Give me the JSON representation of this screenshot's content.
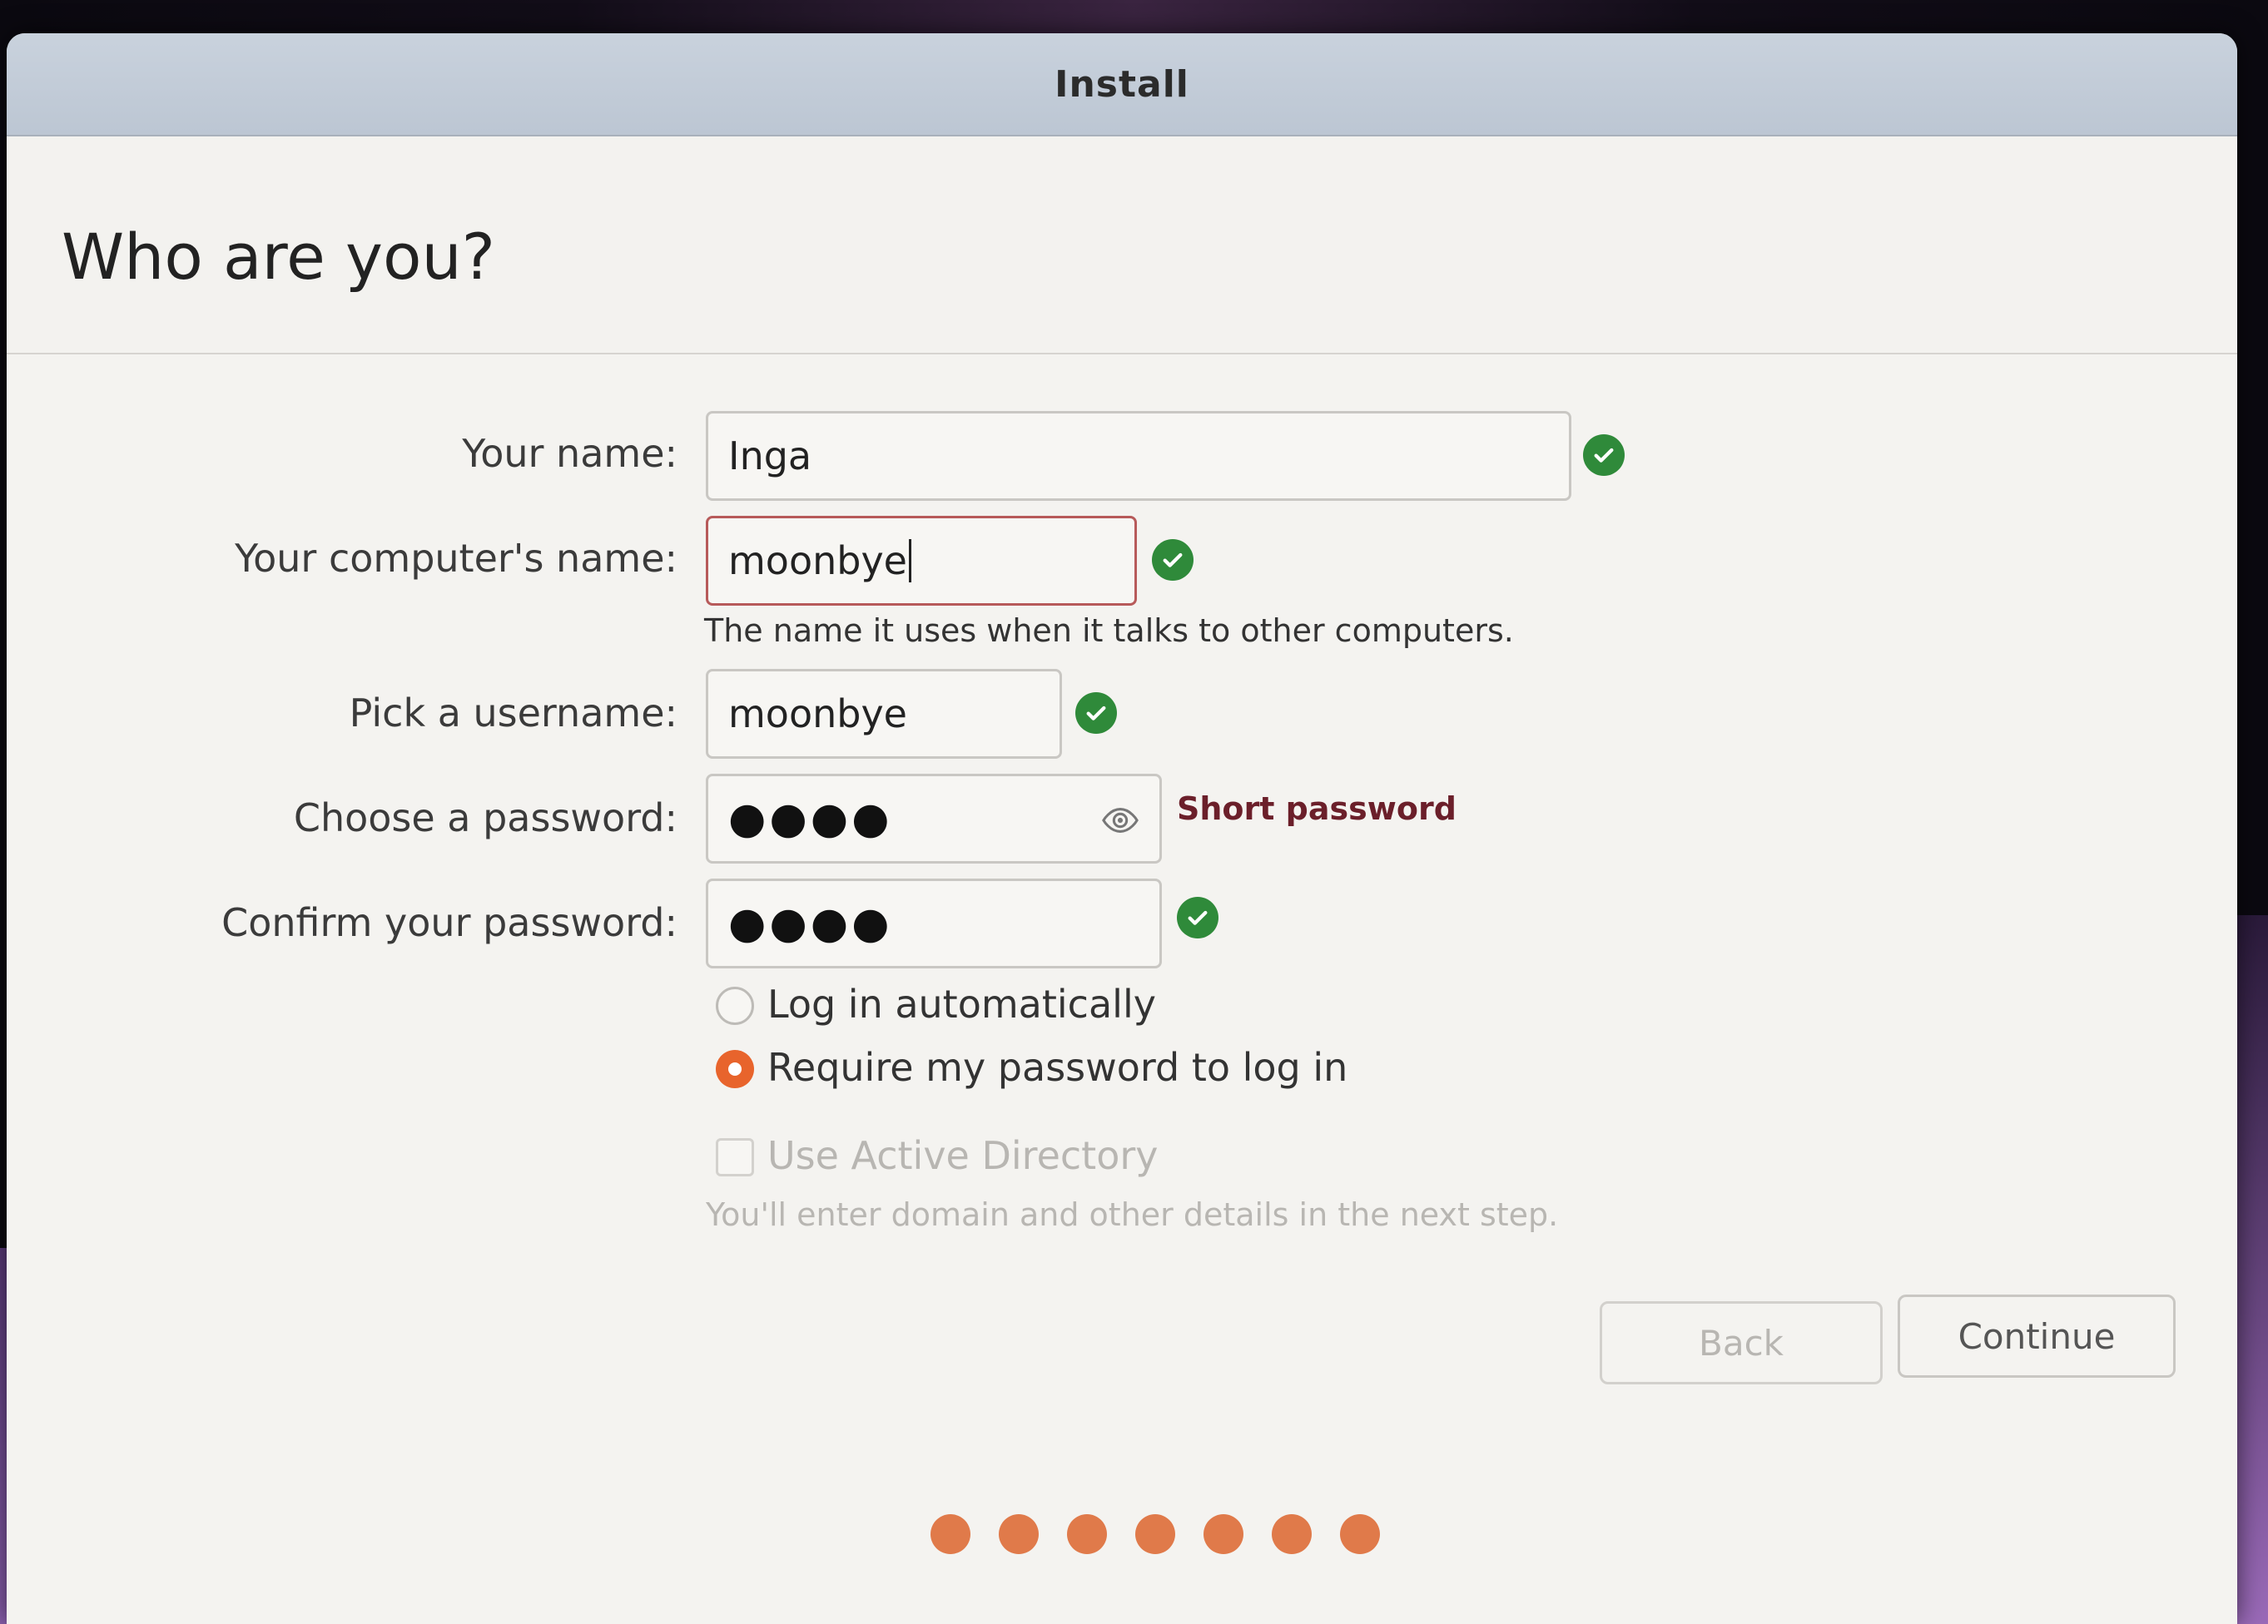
{
  "window": {
    "title": "Install"
  },
  "page": {
    "title": "Who are you?"
  },
  "form": {
    "name_label": "Your name:",
    "name_value": "Inga",
    "computer_label": "Your computer's name:",
    "computer_value": "moonbye",
    "computer_hint": "The name it uses when it talks to other computers.",
    "username_label": "Pick a username:",
    "username_value": "moonbye",
    "password_label": "Choose a password:",
    "password_value": "●●●●",
    "password_strength": "Short password",
    "confirm_label": "Confirm your password:",
    "confirm_value": "●●●●"
  },
  "login_options": {
    "auto_label": "Log in automatically",
    "require_label": "Require my password to log in",
    "selected": "require"
  },
  "active_directory": {
    "label": "Use Active Directory",
    "hint": "You'll enter domain and other details in the next step."
  },
  "buttons": {
    "back": "Back",
    "continue": "Continue"
  },
  "progress": {
    "steps": 7
  },
  "colors": {
    "accent": "#e8642c",
    "valid": "#2f8a3a",
    "error_text": "#6b1f2a",
    "progress_dot": "#e07a4a"
  },
  "icons": {
    "valid": "check-circle-icon",
    "reveal": "eye-icon"
  }
}
